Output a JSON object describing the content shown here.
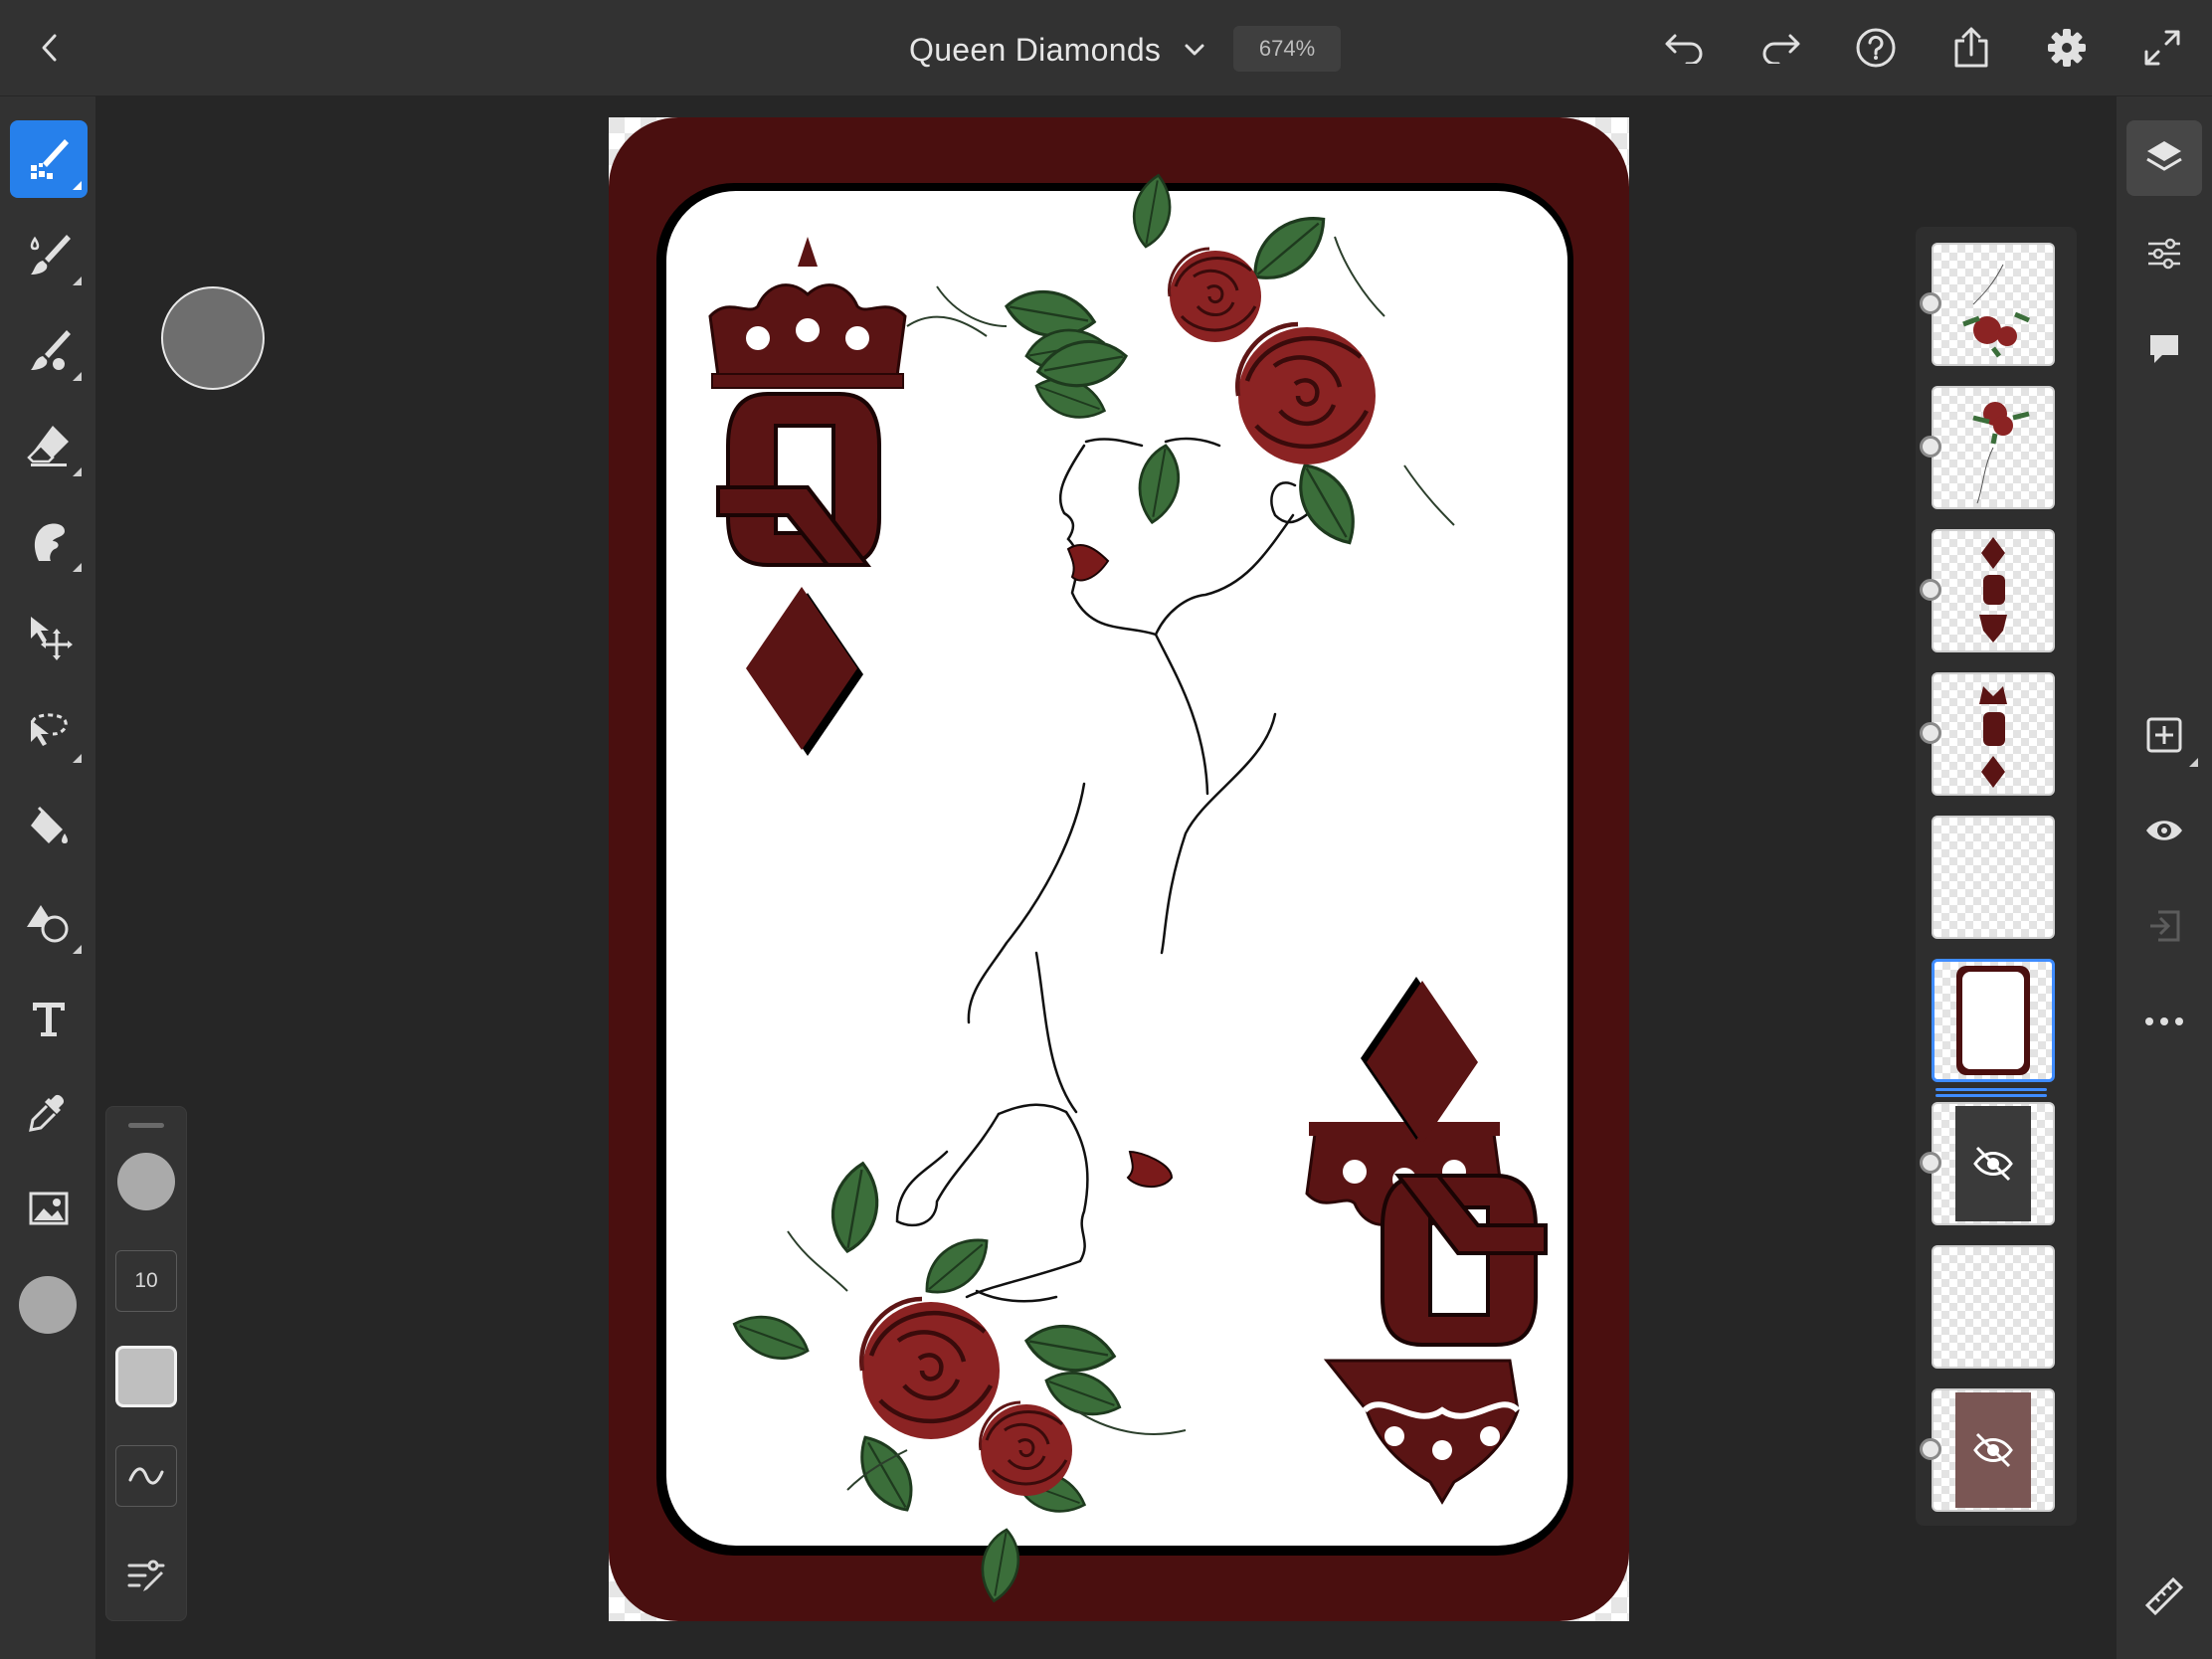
{
  "app": {
    "document_title": "Queen Diamonds",
    "zoom": "674%"
  },
  "brush_panel": {
    "size_value": "10"
  },
  "colors": {
    "accent": "#2680eb",
    "card_border": "#4a0f0f",
    "diamond": "#5a1414",
    "rose": "#8b2323",
    "leaf": "#3b6e3a",
    "current_color": "#6e6e6e"
  },
  "left_tools": [
    {
      "name": "pixel-brush-tool",
      "icon": "pixel-brush-icon",
      "active": true
    },
    {
      "name": "live-brush-tool",
      "icon": "live-brush-icon"
    },
    {
      "name": "vector-brush-tool",
      "icon": "vector-brush-icon"
    },
    {
      "name": "eraser-tool",
      "icon": "eraser-icon"
    },
    {
      "name": "smudge-tool",
      "icon": "smudge-icon"
    },
    {
      "name": "transform-tool",
      "icon": "move-icon"
    },
    {
      "name": "selection-tool",
      "icon": "lasso-icon"
    },
    {
      "name": "fill-tool",
      "icon": "paint-bucket-icon"
    },
    {
      "name": "shape-tool",
      "icon": "shapes-icon"
    },
    {
      "name": "text-tool",
      "icon": "text-icon"
    },
    {
      "name": "eyedropper-tool",
      "icon": "eyedropper-icon"
    },
    {
      "name": "image-tool",
      "icon": "image-icon"
    }
  ],
  "layers": [
    {
      "name": "layer-roses-top",
      "visible": true
    },
    {
      "name": "layer-roses-bottom",
      "visible": true
    },
    {
      "name": "layer-bottom-index",
      "visible": true
    },
    {
      "name": "layer-top-index",
      "visible": true
    },
    {
      "name": "layer-empty-1",
      "visible": true
    },
    {
      "name": "layer-card-frame",
      "visible": true,
      "selected": true
    },
    {
      "name": "layer-hidden-gray",
      "visible": false
    },
    {
      "name": "layer-empty-2",
      "visible": true
    },
    {
      "name": "layer-hidden-maroon",
      "visible": false
    }
  ]
}
